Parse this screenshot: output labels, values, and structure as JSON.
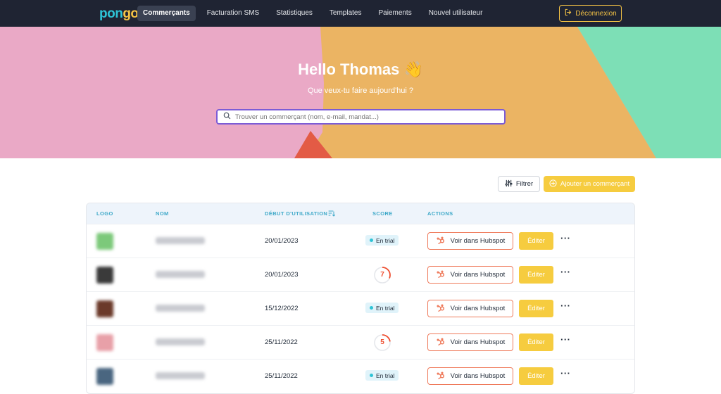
{
  "nav": {
    "logo": {
      "part1": "pon",
      "part2": "go"
    },
    "items": [
      {
        "label": "Commerçants",
        "active": true
      },
      {
        "label": "Facturation SMS",
        "active": false
      },
      {
        "label": "Statistiques",
        "active": false
      },
      {
        "label": "Templates",
        "active": false
      },
      {
        "label": "Paiements",
        "active": false
      },
      {
        "label": "Nouvel utilisateur",
        "active": false
      }
    ],
    "logout_label": "Déconnexion",
    "logout_icon": "logout-icon"
  },
  "hero": {
    "title": "Hello Thomas 👋",
    "subtitle": "Que veux-tu faire aujourd'hui ?",
    "search_placeholder": "Trouver un commerçant (nom, e-mail, mandat...)",
    "search_icon": "search-icon"
  },
  "actions": {
    "filter_label": "Filtrer",
    "filter_icon": "sliders-icon",
    "add_label": "Ajouter un commerçant",
    "add_icon": "plus-circle-icon"
  },
  "table": {
    "headers": {
      "logo": "LOGO",
      "name": "NOM",
      "start": "DÉBUT D'UTILISATION",
      "score": "SCORE",
      "actions": "ACTIONS"
    },
    "hubspot_label": "Voir dans Hubspot",
    "edit_label": "Éditer",
    "more_label": "···",
    "rows": [
      {
        "date": "20/01/2023",
        "score_type": "trial",
        "trial_label": "En trial",
        "avatar_color": "#7cc97a"
      },
      {
        "date": "20/01/2023",
        "score_type": "score",
        "score": "7",
        "avatar_color": "#3a3a3a"
      },
      {
        "date": "15/12/2022",
        "score_type": "trial",
        "trial_label": "En trial",
        "avatar_color": "#6b3a2a"
      },
      {
        "date": "25/11/2022",
        "score_type": "score",
        "score": "5",
        "avatar_color": "#e8a0a8"
      },
      {
        "date": "25/11/2022",
        "score_type": "trial",
        "trial_label": "En trial",
        "avatar_color": "#4a6680"
      }
    ]
  },
  "colors": {
    "nav_bg": "#1f2433",
    "accent_yellow": "#f6cc3f",
    "hero_pink": "#eaa9c6",
    "hero_orange": "#ebb463",
    "hero_green": "#7ddfb6",
    "hero_red": "#e35b45",
    "hubspot_orange": "#ef7b5c",
    "header_teal": "#3fa9c9"
  }
}
